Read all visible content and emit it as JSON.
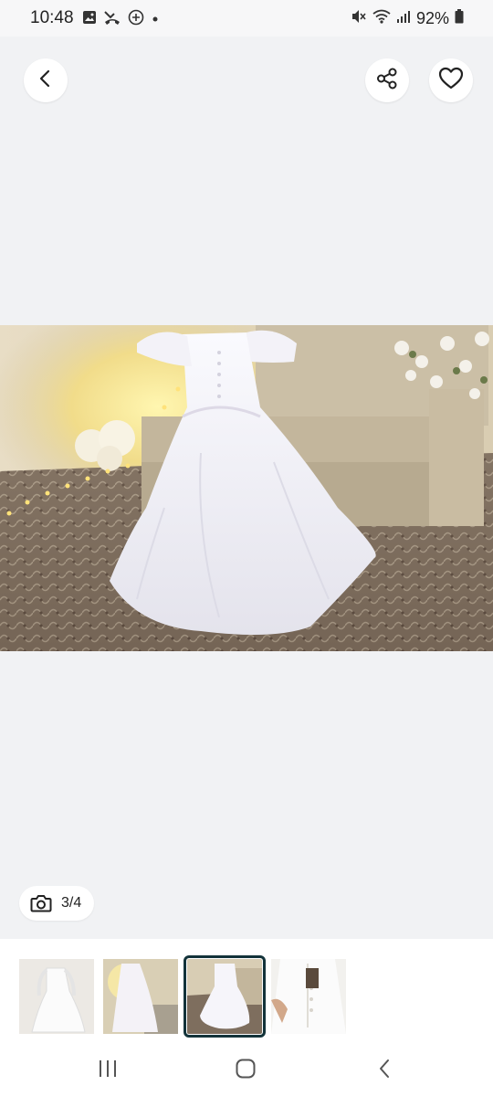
{
  "status_bar": {
    "time": "10:48",
    "battery": "92%",
    "icons": [
      "image-icon",
      "missed-call-icon",
      "add-circle-icon",
      "dot-icon",
      "mute-icon",
      "wifi-icon",
      "signal-icon",
      "battery-icon"
    ]
  },
  "header": {
    "back_icon": "chevron-left-icon",
    "share_icon": "share-icon",
    "favorite_icon": "heart-icon"
  },
  "gallery": {
    "counter": "3/4",
    "counter_icon": "camera-icon",
    "selected_index": 3,
    "thumbnails": [
      "thumbnail-1",
      "thumbnail-2",
      "thumbnail-3",
      "thumbnail-4"
    ]
  },
  "nav_bar": {
    "icons": [
      "recent-apps-icon",
      "home-icon",
      "back-icon"
    ]
  },
  "colors": {
    "background": "#f1f2f4",
    "selected_outline": "#13333a"
  }
}
